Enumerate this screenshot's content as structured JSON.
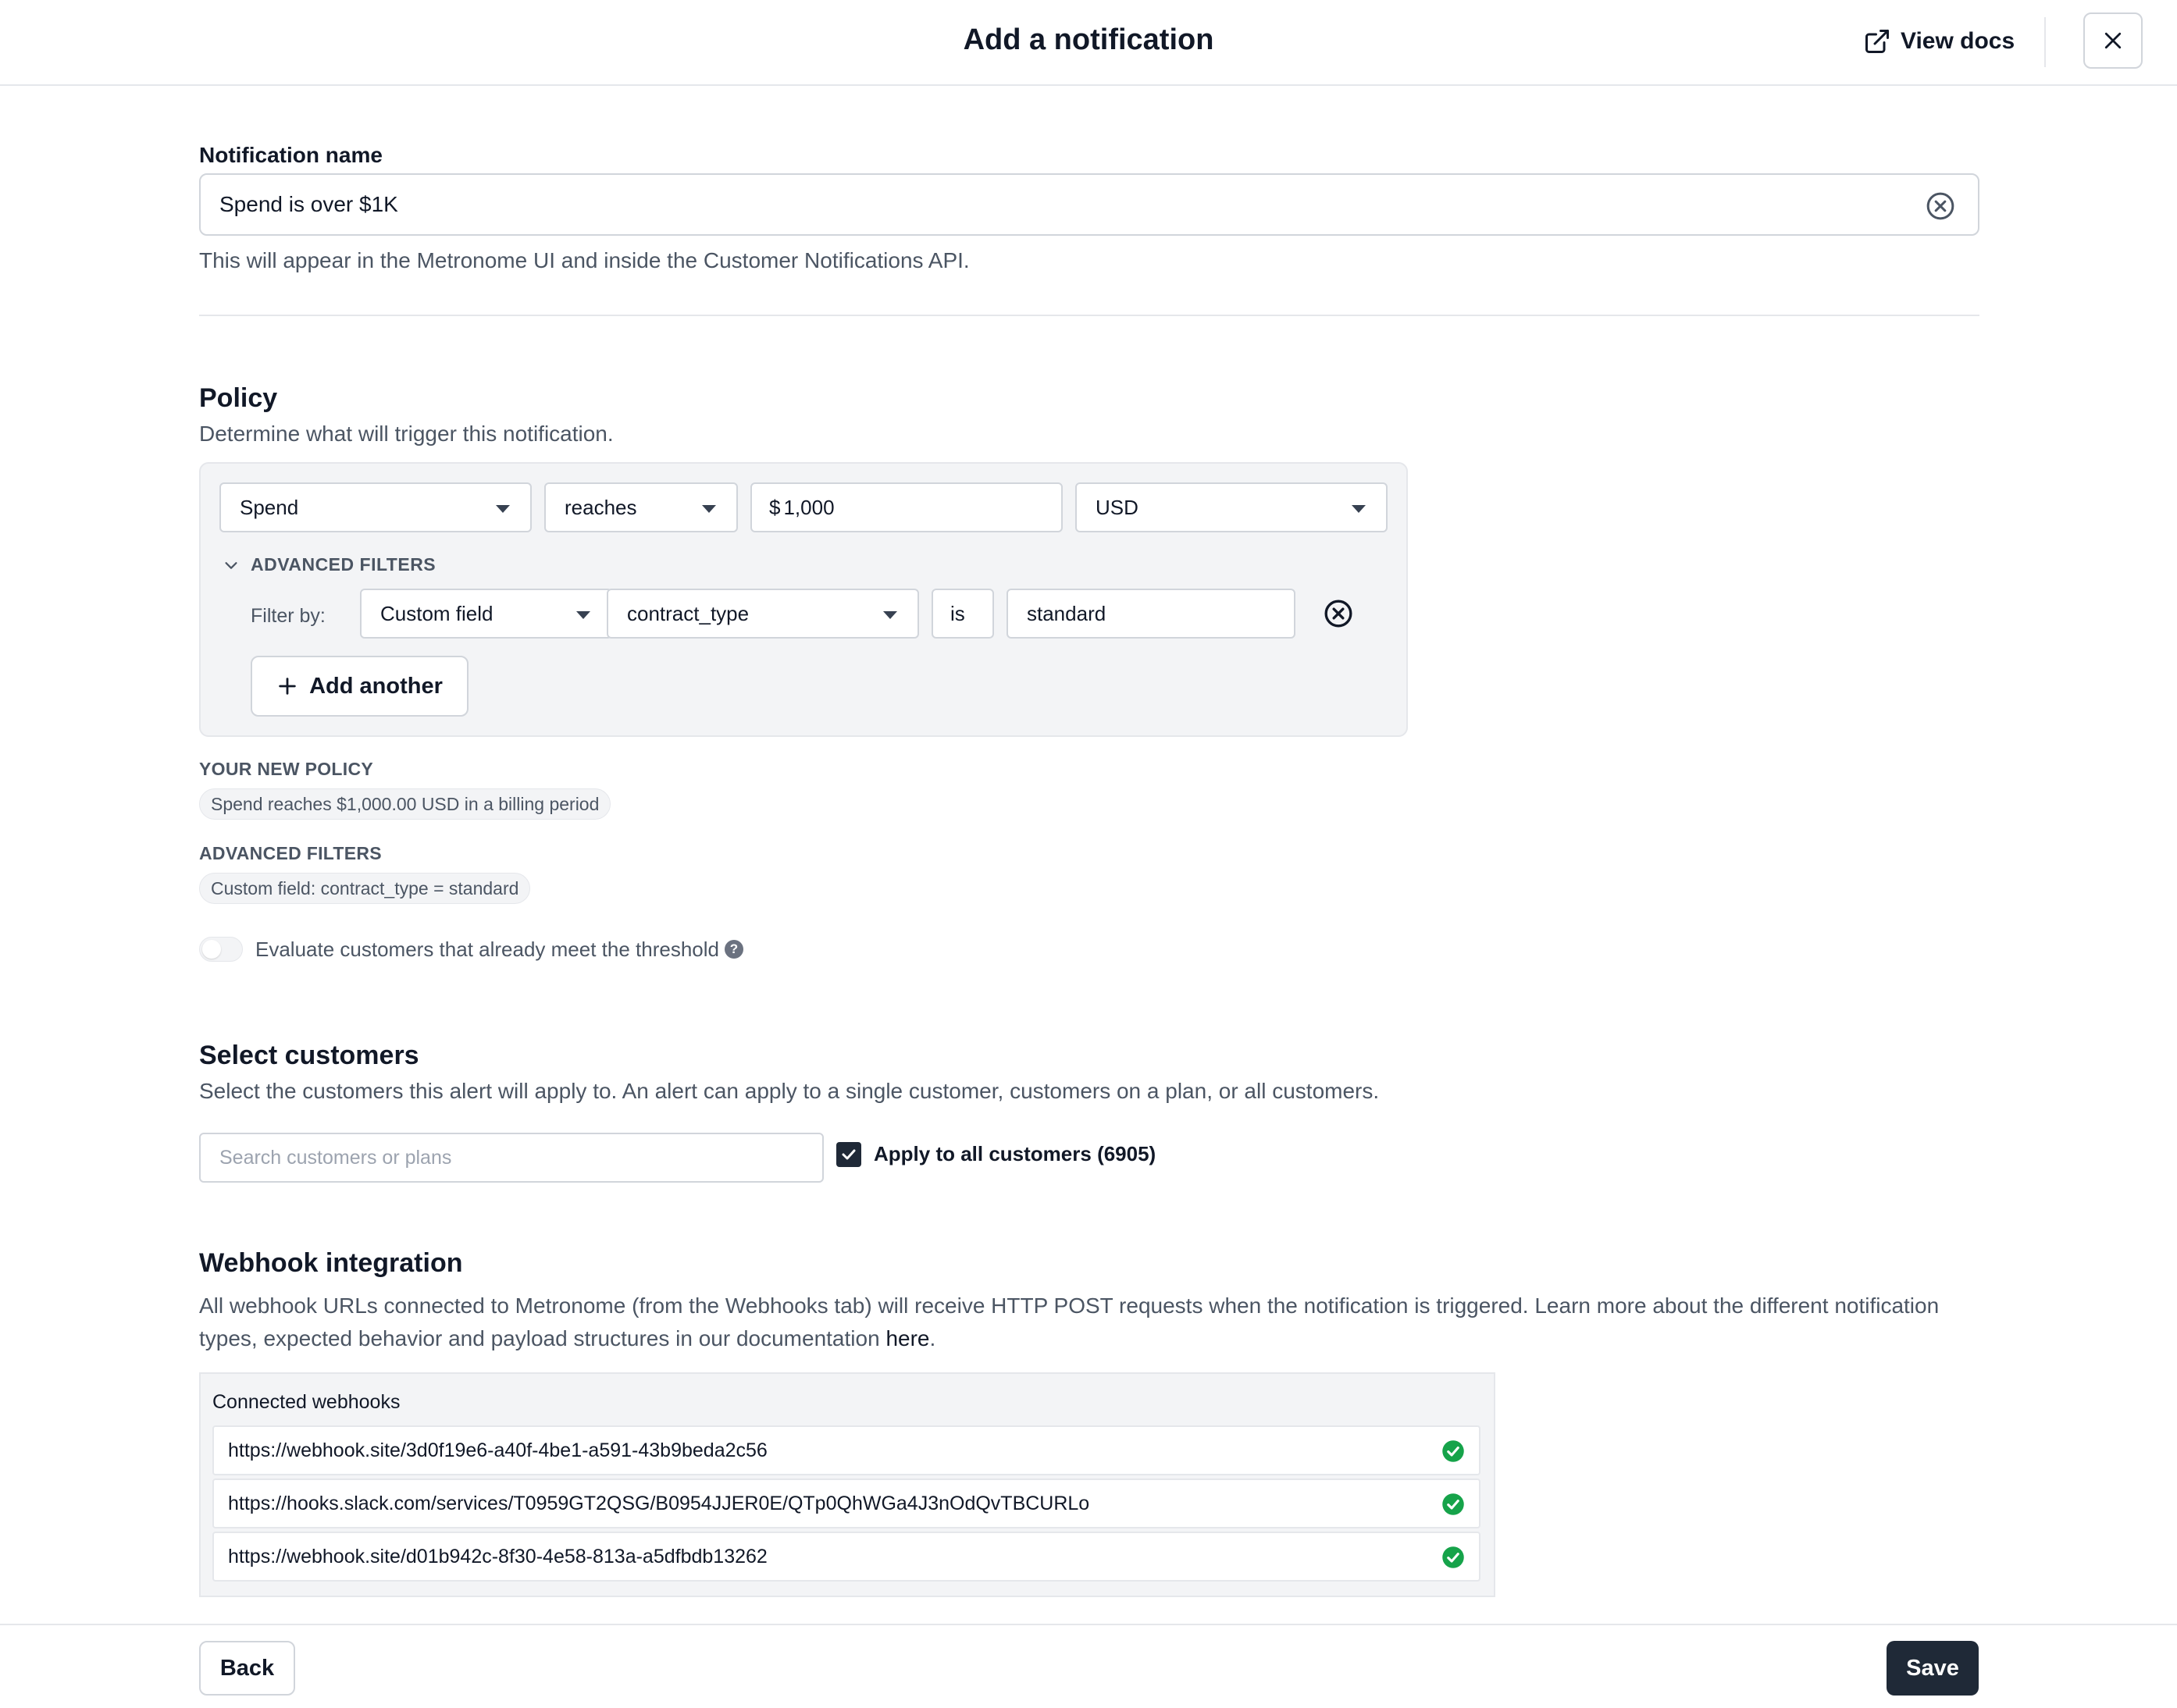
{
  "header": {
    "title": "Add a notification",
    "view_docs_label": "View docs",
    "icons": {
      "view_docs": "external-link-icon",
      "close": "close-icon"
    }
  },
  "notification_name": {
    "label": "Notification name",
    "value": "Spend is over $1K",
    "help": "This will appear in the Metronome UI and inside the Customer Notifications API."
  },
  "policy": {
    "title": "Policy",
    "description": "Determine what will trigger this notification.",
    "metric": "Spend",
    "operator": "reaches",
    "amount_prefix": "$",
    "amount": "1,000",
    "currency": "USD",
    "advanced_filters": {
      "toggle_label": "ADVANCED FILTERS",
      "filter_by_label": "Filter by:",
      "filters": [
        {
          "type": "Custom field",
          "field": "contract_type",
          "operator": "is",
          "value": "standard"
        }
      ],
      "add_another_label": "Add another"
    },
    "summary": {
      "policy_label": "YOUR NEW POLICY",
      "policy_text": "Spend reaches $1,000.00 USD in a billing period",
      "filters_label": "ADVANCED FILTERS",
      "filters_text": "Custom field: contract_type = standard"
    },
    "evaluate_existing": {
      "label": "Evaluate customers that already meet the threshold",
      "enabled": false,
      "help_glyph": "?"
    }
  },
  "customers": {
    "title": "Select customers",
    "description": "Select the customers this alert will apply to. An alert can apply to a single customer, customers on a plan, or all customers.",
    "search_placeholder": "Search customers or plans",
    "search_value": "",
    "apply_all_label": "Apply to all customers (6905)",
    "apply_all_checked": true
  },
  "webhooks": {
    "title": "Webhook integration",
    "description": "All webhook URLs connected to Metronome (from the Webhooks tab) will receive HTTP POST requests when the notification is triggered. Learn more about the different notification types, expected behavior and payload structures in our documentation ",
    "link_text": "here",
    "description_end": ".",
    "connected_label": "Connected webhooks",
    "items": [
      {
        "url": "https://webhook.site/3d0f19e6-a40f-4be1-a591-43b9beda2c56",
        "status": "connected"
      },
      {
        "url": "https://hooks.slack.com/services/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",
        "status": "connected"
      },
      {
        "url": "https://webhook.site/d01b942c-8f30-4e58-813a-a5dfbdb13262",
        "status": "connected"
      }
    ],
    "status_color": "#16a34a"
  },
  "footer": {
    "back_label": "Back",
    "save_label": "Save",
    "save_color": "#1f2937"
  }
}
